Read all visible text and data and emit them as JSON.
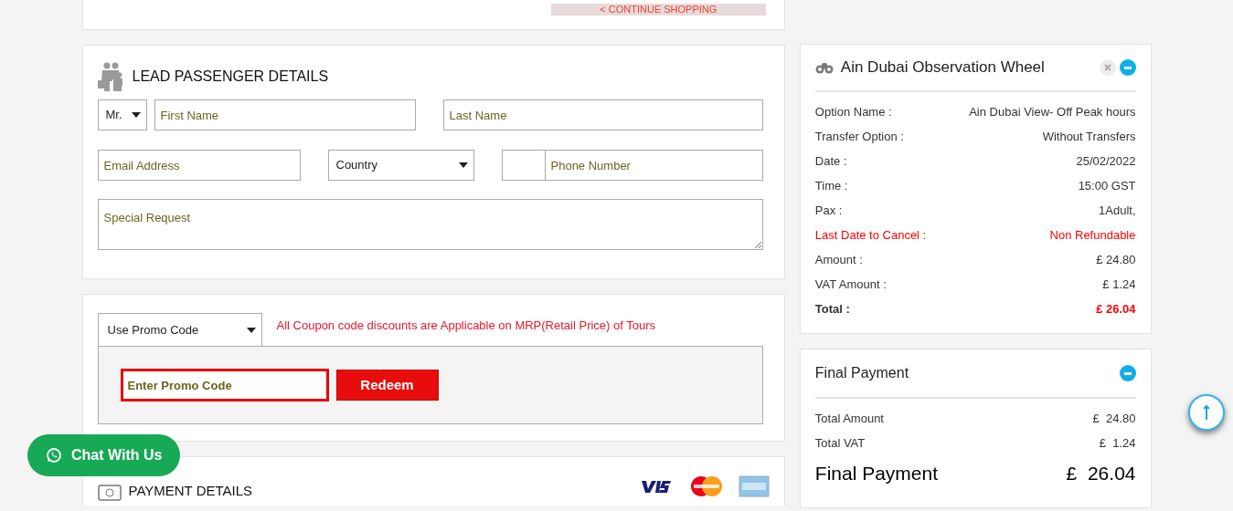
{
  "top_bar": {
    "continue_button": "< CONTINUE  SHOPPING"
  },
  "lead_passenger": {
    "title": "LEAD PASSENGER DETAILS",
    "salutation": "Mr.",
    "first_name": {
      "placeholder": "First Name"
    },
    "last_name": {
      "placeholder": "Last Name"
    },
    "email": {
      "placeholder": "Email Address"
    },
    "country": "Country",
    "phone": {
      "placeholder": "Phone Number"
    },
    "special_request": {
      "placeholder": "Special Request"
    }
  },
  "promo": {
    "dropdown": "Use Promo Code",
    "notice": "All Coupon code discounts are Applicable on MRP(Retail Price) of Tours",
    "field": {
      "placeholder": "Enter Promo Code"
    },
    "redeem_button": "Redeem"
  },
  "payment_details": {
    "title": "PAYMENT DETAILS"
  },
  "tour_summary": {
    "title": "Ain Dubai Observation Wheel",
    "rows": [
      {
        "label": "Option Name :",
        "value": "Ain Dubai View- Off Peak hours",
        "kind": "normal"
      },
      {
        "label": "Transfer Option :",
        "value": "Without Transfers",
        "kind": "normal"
      },
      {
        "label": "Date :",
        "value": "25/02/2022",
        "kind": "normal"
      },
      {
        "label": "Time :",
        "value": "15:00 GST",
        "kind": "normal"
      },
      {
        "label": "Pax :",
        "value": "1Adult,",
        "kind": "normal"
      },
      {
        "label": "Last Date to Cancel :",
        "value": "Non Refundable",
        "kind": "warning"
      },
      {
        "label": "Amount :",
        "value": "£ 24.80",
        "kind": "normal"
      },
      {
        "label": "VAT Amount :",
        "value": "£ 1.24",
        "kind": "normal"
      },
      {
        "label": "Total :",
        "value": "£ 26.04",
        "kind": "total"
      }
    ]
  },
  "final_payment": {
    "title": "Final Payment",
    "rows": [
      {
        "label": "Total Amount",
        "value": "£  24.80"
      },
      {
        "label": "Total VAT",
        "value": "£  1.24"
      }
    ],
    "grand_label": "Final Payment",
    "grand_value": "£  26.04"
  },
  "chat_button": "Chat With Us"
}
